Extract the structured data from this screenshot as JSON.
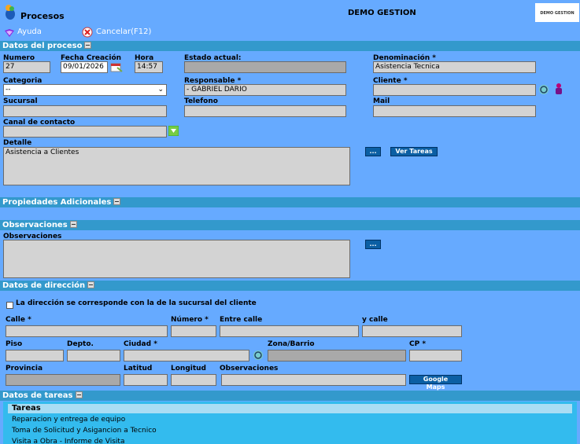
{
  "header": {
    "app_title": "Procesos",
    "center_title": "DEMO GESTION",
    "logo_text": "DEMO GESTION"
  },
  "toolbar": {
    "help_label": "Ayuda",
    "cancel_label": "Cancelar(F12)"
  },
  "sections": {
    "datos_proceso": "Datos del proceso",
    "propiedades": "Propiedades Adicionales",
    "observaciones": "Observaciones",
    "direccion": "Datos de dirección",
    "tareas": "Datos de tareas"
  },
  "proceso": {
    "numero_label": "Numero",
    "numero_value": "27",
    "fecha_label": "Fecha Creación",
    "fecha_value": "09/01/2026",
    "hora_label": "Hora",
    "hora_value": "14:57",
    "estado_label": "Estado actual:",
    "estado_value": "",
    "denominacion_label": "Denominación *",
    "denominacion_value": "Asistencia Tecnica",
    "categoria_label": "Categoria",
    "categoria_value": "--",
    "responsable_label": "Responsable *",
    "responsable_value": "- GABRIEL DARIO",
    "cliente_label": "Cliente *",
    "cliente_value": "",
    "sucursal_label": "Sucursal",
    "telefono_label": "Telefono",
    "mail_label": "Mail",
    "canal_label": "Canal de contacto",
    "detalle_label": "Detalle",
    "detalle_value": "Asistencia a Clientes",
    "dots_label": "...",
    "ver_tareas_label": "Ver Tareas"
  },
  "observaciones": {
    "label": "Observaciones",
    "value": "",
    "dots_label": "..."
  },
  "direccion": {
    "checkbox_label": "La dirección se corresponde con la de la sucursal del cliente",
    "calle_label": "Calle *",
    "numero_label": "Número *",
    "entre_calle_label": "Entre calle",
    "y_calle_label": "y calle",
    "piso_label": "Piso",
    "depto_label": "Depto.",
    "ciudad_label": "Ciudad *",
    "zona_label": "Zona/Barrio",
    "cp_label": "CP *",
    "provincia_label": "Provincia",
    "latitud_label": "Latitud",
    "longitud_label": "Longitud",
    "observaciones_label": "Observaciones",
    "google_maps_label": "Google Maps"
  },
  "tareas": {
    "header": "Tareas",
    "items": [
      "Reparacion y entrega de equipo",
      "Toma de Solicitud y Asigancion a Tecnico",
      "Visita a Obra - Informe de Visita"
    ]
  },
  "colors": {
    "background": "#66aaff",
    "section_bar": "#3399cc",
    "button": "#0b5fa4",
    "tasks_panel": "#33bbee"
  }
}
